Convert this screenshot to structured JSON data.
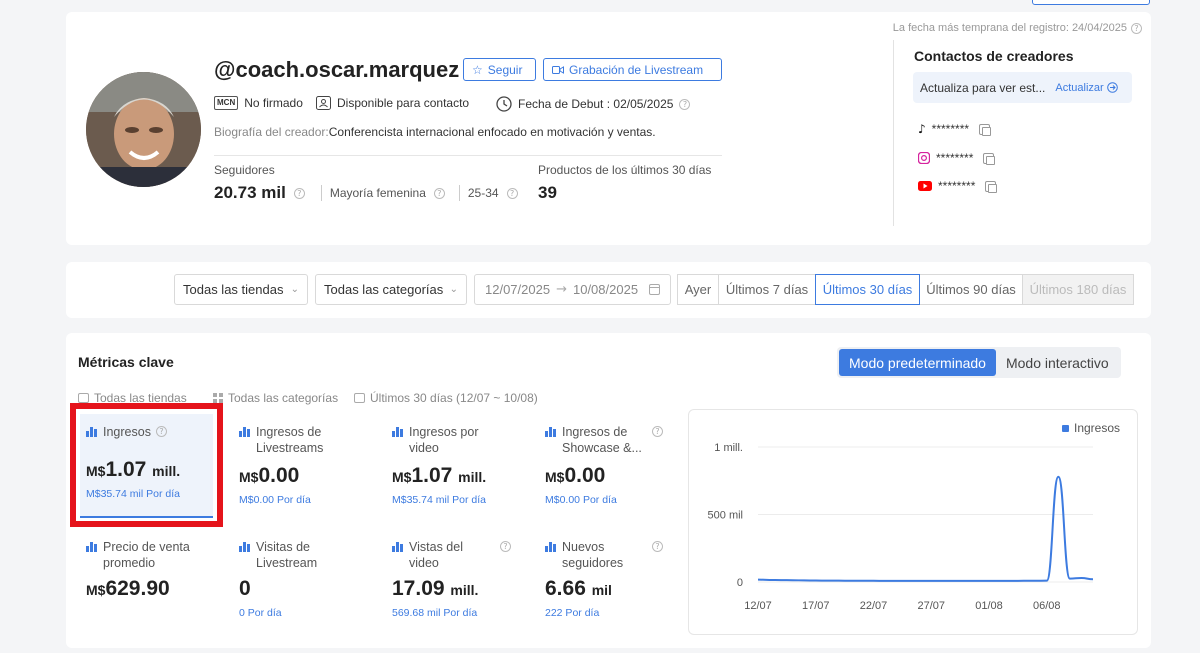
{
  "profile": {
    "earliest_record": "La fecha más temprana del registro: 24/04/2025",
    "username": "@coach.oscar.marquez",
    "follow_label": "Seguir",
    "livestream_label": "Grabación de Livestream",
    "mcn_badge": "MCN",
    "mcn_status": "No firmado",
    "contact_status": "Disponible para contacto",
    "debut_date": "Fecha de Debut : 02/05/2025",
    "bio_label": "Biografía del creador:",
    "bio_text": "Conferencista internacional enfocado en motivación y ventas.",
    "followers_label": "Seguidores",
    "followers_value": "20.73 mil",
    "audience_gender": "Mayoría femenina",
    "audience_age": "25-34",
    "products_label": "Productos de los últimos 30 días",
    "products_value": "39"
  },
  "contacts": {
    "title": "Contactos de creadores",
    "update_text": "Actualiza para ver est...",
    "update_link": "Actualizar",
    "tiktok": "********",
    "instagram": "********",
    "youtube": "********"
  },
  "filters": {
    "store": "Todas las tiendas",
    "category": "Todas las categorías",
    "date_start": "12/07/2025",
    "date_arrow": "→",
    "date_end": "10/08/2025",
    "ranges": [
      "Ayer",
      "Últimos 7 días",
      "Últimos 30 días",
      "Últimos 90 días",
      "Últimos 180 días"
    ],
    "active_range": "Últimos 30 días"
  },
  "metrics": {
    "title": "Métricas clave",
    "mode_default": "Modo predeterminado",
    "mode_interactive": "Modo interactivo",
    "info_store": "Todas las tiendas",
    "info_category": "Todas las categorías",
    "info_period": "Últimos 30 días (12/07 ~ 10/08)",
    "items": [
      {
        "label": "Ingresos",
        "currency": "M$",
        "value": "1.07",
        "unit": "mill.",
        "sub": "M$35.74 mil Por día"
      },
      {
        "label": "Ingresos de Livestreams",
        "currency": "M$",
        "value": "0.00",
        "unit": "",
        "sub": "M$0.00 Por día"
      },
      {
        "label": "Ingresos por video",
        "currency": "M$",
        "value": "1.07",
        "unit": "mill.",
        "sub": "M$35.74 mil Por día"
      },
      {
        "label": "Ingresos de Showcase &...",
        "currency": "M$",
        "value": "0.00",
        "unit": "",
        "sub": "M$0.00 Por día"
      },
      {
        "label": "Precio de venta promedio",
        "currency": "M$",
        "value": "629.90",
        "unit": "",
        "sub": ""
      },
      {
        "label": "Visitas de Livestream",
        "currency": "",
        "value": "0",
        "unit": "",
        "sub": "0 Por día"
      },
      {
        "label": "Vistas del video",
        "currency": "",
        "value": "17.09",
        "unit": "mill.",
        "sub": "569.68 mil Por día"
      },
      {
        "label": "Nuevos seguidores",
        "currency": "",
        "value": "6.66",
        "unit": "mil",
        "sub": "222 Por día"
      }
    ]
  },
  "chart_data": {
    "type": "line",
    "series": [
      {
        "name": "Ingresos",
        "values": [
          18000,
          15000,
          14000,
          13000,
          12000,
          11000,
          10000,
          10000,
          9000,
          9000,
          9000,
          8000,
          8000,
          8000,
          8000,
          8000,
          8000,
          8000,
          8000,
          8000,
          8000,
          8000,
          8000,
          9000,
          9000,
          10000,
          780000,
          25000,
          30000,
          20000
        ]
      }
    ],
    "x": [
      "12/07",
      "13/07",
      "14/07",
      "15/07",
      "16/07",
      "17/07",
      "18/07",
      "19/07",
      "20/07",
      "21/07",
      "22/07",
      "23/07",
      "24/07",
      "25/07",
      "26/07",
      "27/07",
      "28/07",
      "29/07",
      "30/07",
      "31/07",
      "01/08",
      "02/08",
      "03/08",
      "04/08",
      "05/08",
      "06/08",
      "07/08",
      "08/08",
      "09/08",
      "10/08"
    ],
    "x_ticks": [
      "12/07",
      "17/07",
      "22/07",
      "27/07",
      "01/08",
      "06/08"
    ],
    "y_ticks": [
      "0",
      "500 mil",
      "1 mill."
    ],
    "y_tick_values": [
      0,
      500000,
      1000000
    ],
    "ylim": [
      0,
      1000000
    ],
    "legend_position": "top-right",
    "grid": true,
    "color": "#3d7be0"
  }
}
